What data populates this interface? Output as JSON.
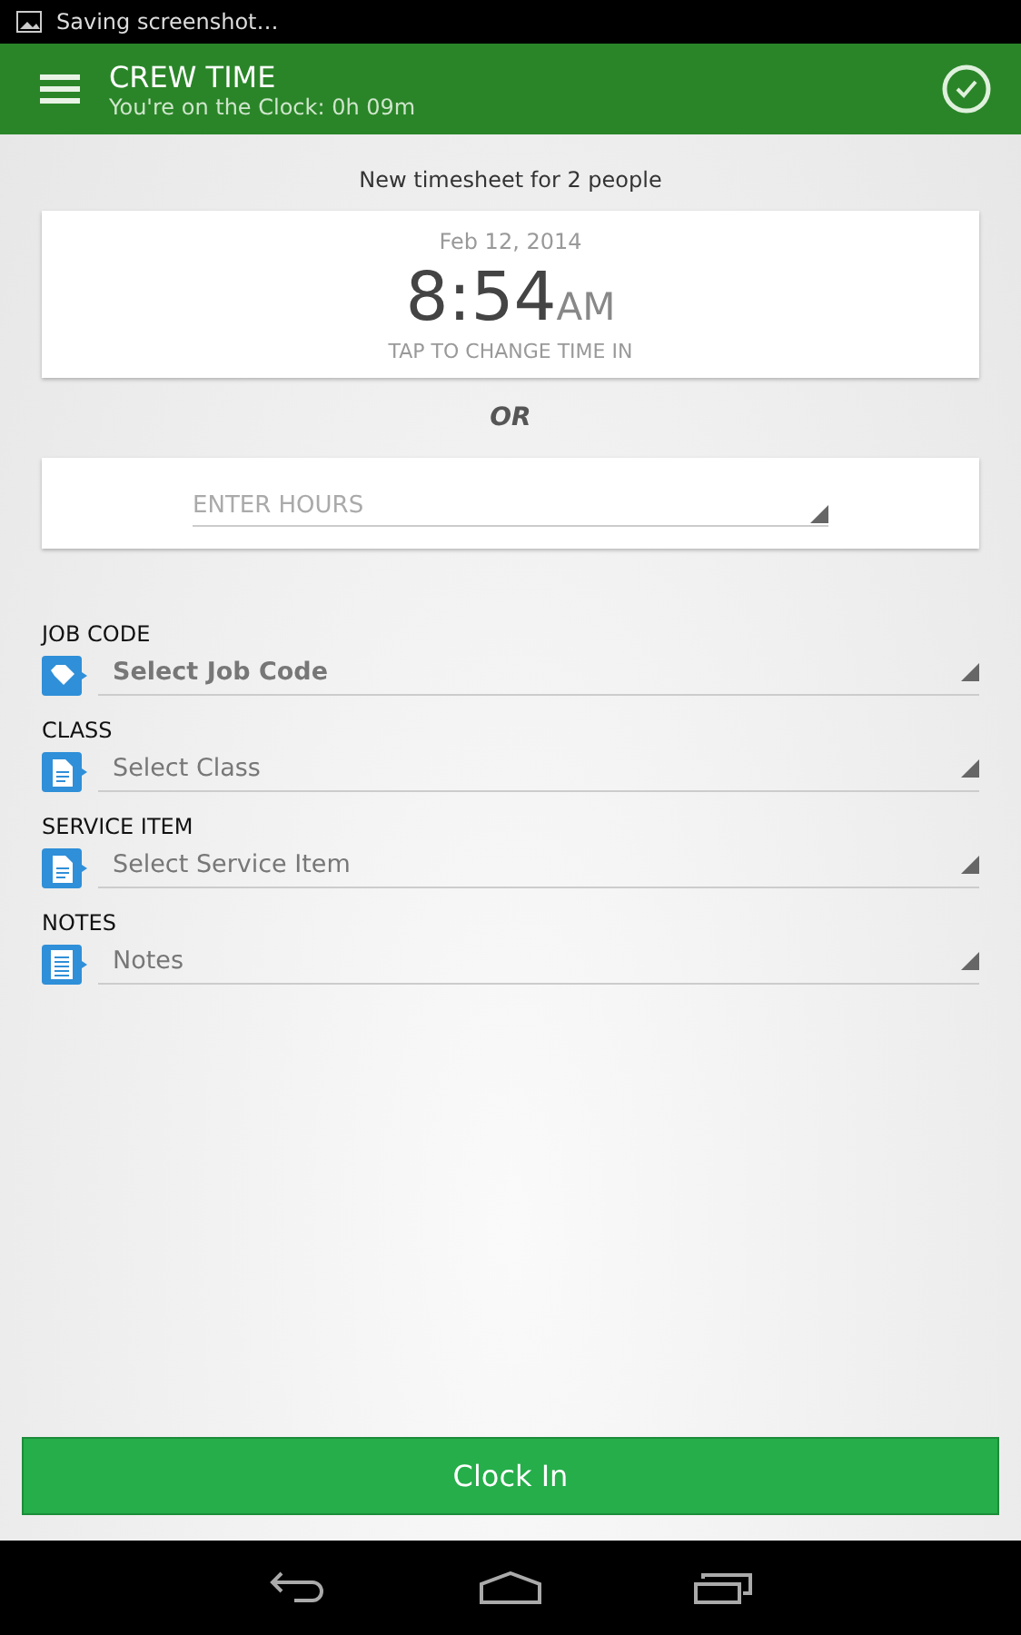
{
  "status_bar": {
    "notification": "Saving screenshot…"
  },
  "app_bar": {
    "title": "CREW TIME",
    "subtitle": "You're on the Clock: 0h 09m"
  },
  "header": "New timesheet for 2 people",
  "time_card": {
    "date": "Feb 12, 2014",
    "time": "8:54",
    "ampm": "AM",
    "hint": "TAP TO CHANGE TIME IN"
  },
  "separator": "OR",
  "hours": {
    "placeholder": "ENTER HOURS"
  },
  "fields": [
    {
      "label": "JOB CODE",
      "kind": "tag",
      "value": "Select Job Code",
      "emphasized": true
    },
    {
      "label": "CLASS",
      "kind": "document",
      "value": "Select Class",
      "emphasized": false
    },
    {
      "label": "SERVICE ITEM",
      "kind": "document",
      "value": "Select Service Item",
      "emphasized": false
    },
    {
      "label": "NOTES",
      "kind": "notepad",
      "value": "Notes",
      "emphasized": false
    }
  ],
  "primary_button": "Clock In"
}
